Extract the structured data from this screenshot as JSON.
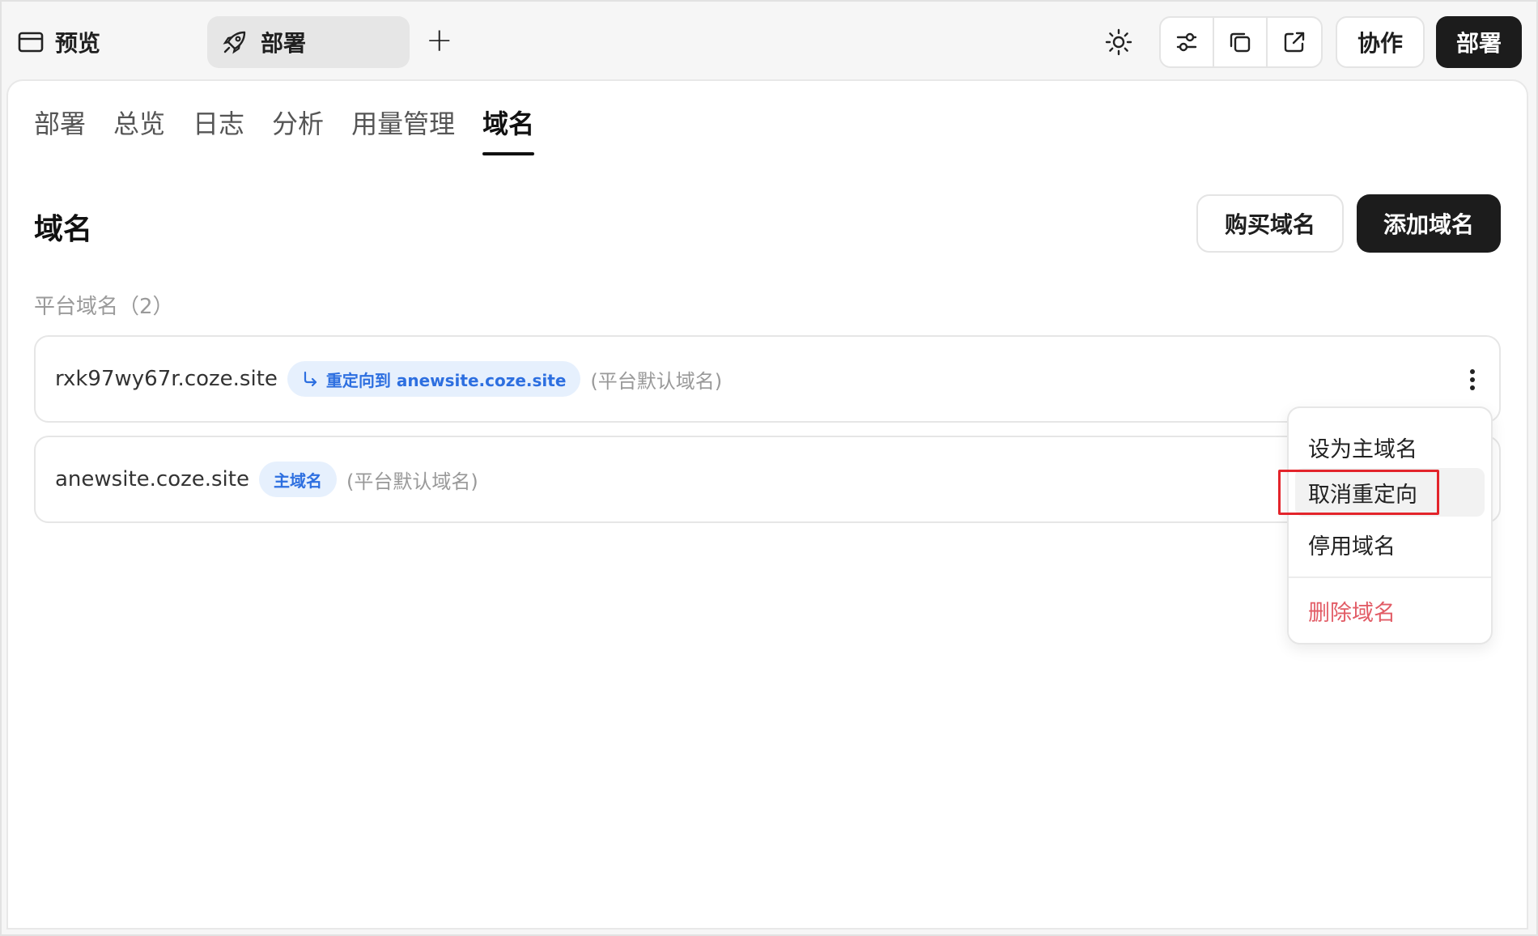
{
  "topbar": {
    "preview_label": "预览",
    "deploy_tab_label": "部署",
    "add_tab_symbol": "+",
    "collab_label": "协作",
    "deploy_button_label": "部署"
  },
  "tabs": [
    {
      "label": "部署"
    },
    {
      "label": "总览"
    },
    {
      "label": "日志"
    },
    {
      "label": "分析"
    },
    {
      "label": "用量管理"
    },
    {
      "label": "域名",
      "active": true
    }
  ],
  "page": {
    "title": "域名",
    "buy_label": "购买域名",
    "add_label": "添加域名",
    "section_label": "平台域名（2）"
  },
  "domains": [
    {
      "name": "rxk97wy67r.coze.site",
      "tag": "重定向到 anewsite.coze.site",
      "note": "(平台默认域名)"
    },
    {
      "name": "anewsite.coze.site",
      "tag": "主域名",
      "note": "(平台默认域名)"
    }
  ],
  "menu": {
    "items": [
      "设为主域名",
      "取消重定向",
      "停用域名",
      "删除域名"
    ]
  },
  "colors": {
    "accent_dark": "#1c1c1c",
    "tag_blue": "#2d6fe0",
    "danger": "#e25c66",
    "highlight_red": "#e3242b"
  }
}
